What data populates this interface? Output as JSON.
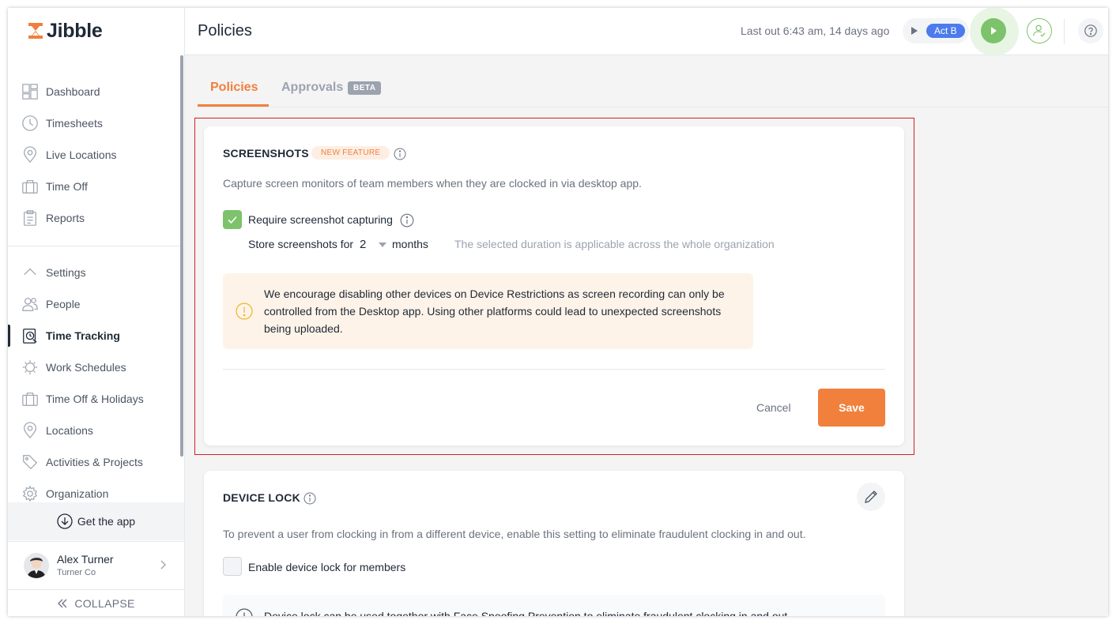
{
  "brand": {
    "name": "Jibble",
    "accent": "#f0803c",
    "green": "#7cc36b"
  },
  "sidebar": {
    "items_top": [
      {
        "label": "Dashboard",
        "icon": "dashboard-icon"
      },
      {
        "label": "Timesheets",
        "icon": "clock-icon"
      },
      {
        "label": "Live Locations",
        "icon": "location-pin-icon"
      },
      {
        "label": "Time Off",
        "icon": "suitcase-icon"
      },
      {
        "label": "Reports",
        "icon": "clipboard-icon"
      }
    ],
    "items_settings": [
      {
        "label": "Settings",
        "icon": "chevron-up-icon"
      },
      {
        "label": "People",
        "icon": "people-icon"
      },
      {
        "label": "Time Tracking",
        "icon": "time-tracking-icon",
        "active": true
      },
      {
        "label": "Work Schedules",
        "icon": "schedule-icon"
      },
      {
        "label": "Time Off & Holidays",
        "icon": "suitcase-icon"
      },
      {
        "label": "Locations",
        "icon": "location-pin-icon"
      },
      {
        "label": "Activities & Projects",
        "icon": "tag-icon"
      },
      {
        "label": "Organization",
        "icon": "gear-icon"
      }
    ],
    "get_app": "Get the app",
    "user": {
      "name": "Alex Turner",
      "org": "Turner Co"
    },
    "collapse": "COLLAPSE"
  },
  "header": {
    "title": "Policies",
    "last_out": "Last out 6:43 am, 14 days ago",
    "activity_badge": "Act B"
  },
  "tabs": [
    {
      "label": "Policies",
      "active": true
    },
    {
      "label": "Approvals",
      "badge": "BETA"
    }
  ],
  "screenshots": {
    "title": "SCREENSHOTS",
    "badge": "NEW FEATURE",
    "description": "Capture screen monitors of team members when they are clocked in via desktop app.",
    "checkbox_label": "Require screenshot capturing",
    "checked": true,
    "store_label": "Store screenshots for",
    "store_value": "2",
    "store_unit": "months",
    "store_hint": "The selected duration is applicable across the whole organization",
    "warning": "We encourage disabling other devices on Device Restrictions as screen recording can only be controlled from the Desktop app. Using other platforms could lead to unexpected screenshots being uploaded.",
    "cancel": "Cancel",
    "save": "Save"
  },
  "device_lock": {
    "title": "DEVICE LOCK",
    "description": "To prevent a user from clocking in from a different device, enable this setting to eliminate fraudulent clocking in and out.",
    "checkbox_label": "Enable device lock for members",
    "checked": false,
    "info": "Device lock can be used together with Face Spoofing Prevention to eliminate fraudulent clocking in and out."
  }
}
